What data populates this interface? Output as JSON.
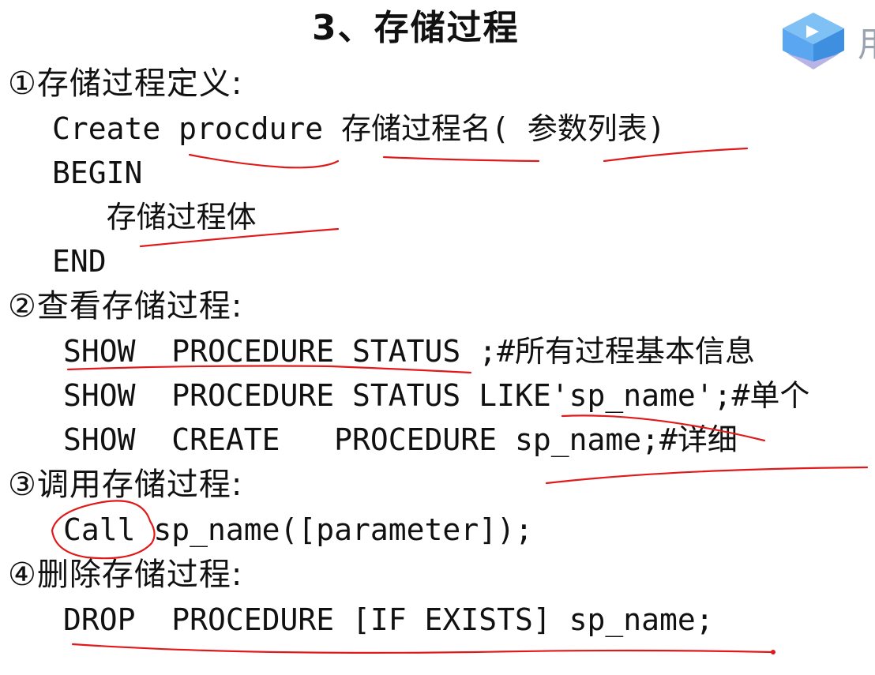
{
  "slide": {
    "title": "3、存储过程",
    "sections": [
      {
        "heading": "①存储过程定义:",
        "lines": [
          "Create procdure 存储过程名( 参数列表)",
          "BEGIN",
          "   存储过程体",
          "END"
        ]
      },
      {
        "heading": "②查看存储过程:",
        "lines": [
          "SHOW  PROCEDURE STATUS ;#所有过程基本信息",
          "SHOW  PROCEDURE STATUS LIKE'sp_name';#单个",
          "SHOW  CREATE   PROCEDURE sp_name;#详细"
        ]
      },
      {
        "heading": "③调用存储过程:",
        "lines": [
          "Call sp_name([parameter]);"
        ]
      },
      {
        "heading": "④删除存储过程:",
        "lines": [
          "DROP  PROCEDURE [IF EXISTS] sp_name;"
        ]
      }
    ],
    "edge_text": "用",
    "colors": {
      "text": "#111111",
      "annotation": "#e01a1a",
      "logo": "#5aa6f0"
    }
  }
}
